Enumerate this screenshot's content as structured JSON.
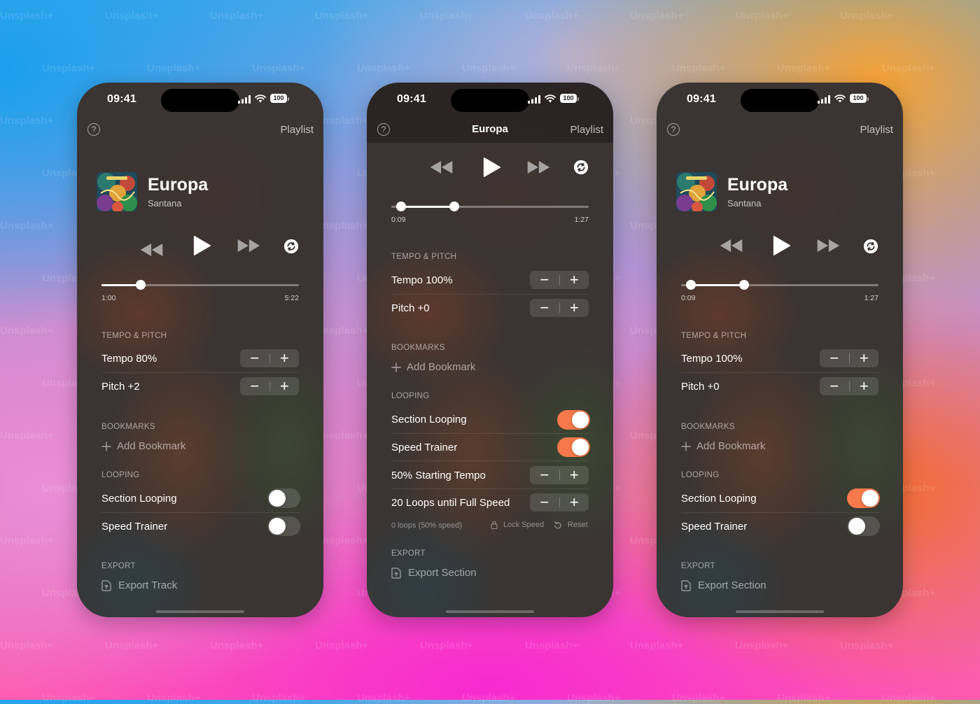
{
  "watermark": "Unsplash+",
  "colors": {
    "toggle_on": "#f5794a",
    "screen_bg": "#3a3432"
  },
  "phones": [
    {
      "status": {
        "time": "09:41",
        "battery": "100"
      },
      "nav": {
        "help_icon": "?",
        "playlist": "Playlist"
      },
      "track": {
        "title": "Europa",
        "artist": "Santana"
      },
      "progress": {
        "elapsed": "1:00",
        "total": "5:22",
        "position_fraction": 0.2
      },
      "sections": {
        "tempo_pitch": "TEMPO & PITCH",
        "bookmarks": "BOOKMARKS",
        "looping": "LOOPING",
        "export": "EXPORT"
      },
      "tempo": {
        "label": "Tempo 80%"
      },
      "pitch": {
        "label": "Pitch +2"
      },
      "add_bookmark": "Add Bookmark",
      "section_looping": {
        "label": "Section Looping",
        "on": false
      },
      "speed_trainer": {
        "label": "Speed Trainer",
        "on": false
      },
      "export_label": "Export Track"
    },
    {
      "status": {
        "time": "09:41",
        "battery": "100"
      },
      "nav": {
        "help_icon": "?",
        "title": "Europa",
        "playlist": "Playlist"
      },
      "progress": {
        "elapsed": "0:09",
        "total": "1:27",
        "loop_start_fraction": 0.05,
        "position_fraction": 0.32
      },
      "sections": {
        "tempo_pitch": "TEMPO & PITCH",
        "bookmarks": "BOOKMARKS",
        "looping": "LOOPING",
        "export": "EXPORT"
      },
      "tempo": {
        "label": "Tempo 100%"
      },
      "pitch": {
        "label": "Pitch +0"
      },
      "add_bookmark": "Add Bookmark",
      "section_looping": {
        "label": "Section Looping",
        "on": true
      },
      "speed_trainer": {
        "label": "Speed Trainer",
        "on": true
      },
      "starting_tempo": {
        "label": "50% Starting Tempo"
      },
      "loops_until": {
        "label": "20 Loops until Full Speed"
      },
      "loop_status": "0 loops (50% speed)",
      "lock_speed": "Lock Speed",
      "reset": "Reset",
      "export_label": "Export Section"
    },
    {
      "status": {
        "time": "09:41",
        "battery": "100"
      },
      "nav": {
        "help_icon": "?",
        "playlist": "Playlist"
      },
      "track": {
        "title": "Europa",
        "artist": "Santana"
      },
      "progress": {
        "elapsed": "0:09",
        "total": "1:27",
        "loop_start_fraction": 0.05,
        "position_fraction": 0.32
      },
      "sections": {
        "tempo_pitch": "TEMPO & PITCH",
        "bookmarks": "BOOKMARKS",
        "looping": "LOOPING",
        "export": "EXPORT"
      },
      "tempo": {
        "label": "Tempo 100%"
      },
      "pitch": {
        "label": "Pitch +0"
      },
      "add_bookmark": "Add Bookmark",
      "section_looping": {
        "label": "Section Looping",
        "on": true
      },
      "speed_trainer": {
        "label": "Speed Trainer",
        "on": false
      },
      "export_label": "Export Section"
    }
  ]
}
